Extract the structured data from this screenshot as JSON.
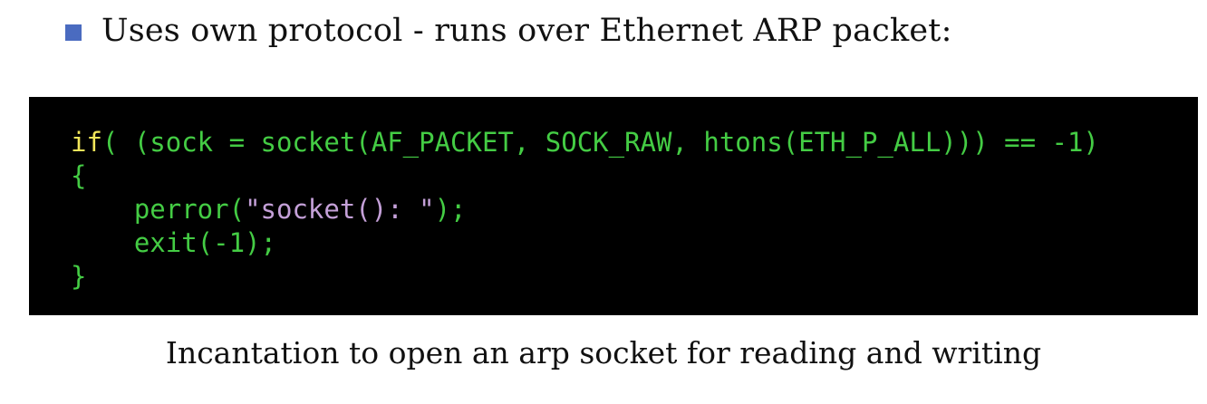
{
  "bullet": {
    "icon": "square-bullet-icon",
    "color": "#4a6bc0",
    "text": "Uses own protocol - runs over Ethernet ARP packet:"
  },
  "code": {
    "background": "#000000",
    "lines": [
      [
        {
          "t": "if",
          "c": "kw"
        },
        {
          "t": "( (sock = socket(AF_PACKET, SOCK_RAW, htons(ETH_P_ALL))) == -1)",
          "c": "ident"
        }
      ],
      [
        {
          "t": "{",
          "c": "punc"
        }
      ],
      [
        {
          "t": "    perror(",
          "c": "ident"
        },
        {
          "t": "\"socket(): \"",
          "c": "str"
        },
        {
          "t": ");",
          "c": "ident"
        }
      ],
      [
        {
          "t": "    exit(-1);",
          "c": "ident"
        }
      ],
      [
        {
          "t": "}",
          "c": "punc"
        }
      ]
    ]
  },
  "caption": "Incantation to open an arp socket for reading and writing"
}
